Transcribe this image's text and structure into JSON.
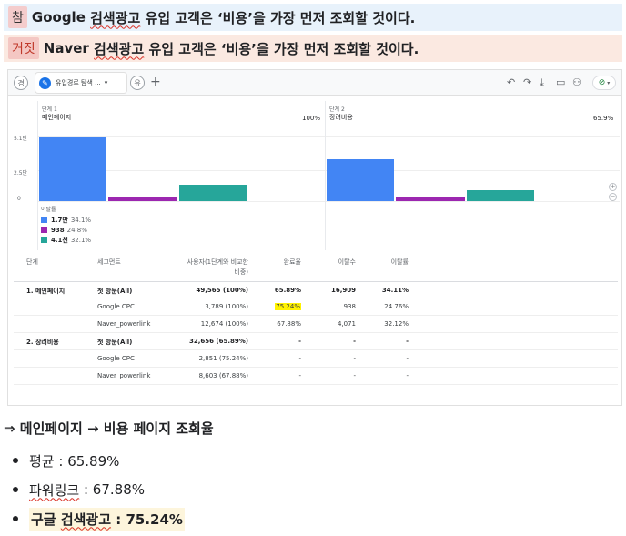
{
  "statements": {
    "true_tag": "참",
    "true_pre": "Google ",
    "true_squig": "검색광고",
    "true_post": " 유입 고객은 ‘비용’을 가장 먼저 조회할 것이다.",
    "false_tag": "거짓",
    "false_pre": "Naver ",
    "false_squig": "검색광고",
    "false_post": " 유입 고객은 ‘비용’을 가장 먼저 조회할 것이다."
  },
  "toolbar": {
    "left_badge": "경",
    "tab_label": "유입경로 탐색 ...",
    "tab_caret": "▾",
    "user_badge": "유",
    "add_label": "+",
    "icons": [
      "undo-icon",
      "redo-icon",
      "download-icon",
      "folder-icon",
      "share-user-icon",
      "status-check-icon"
    ],
    "undo_glyph": "↶",
    "redo_glyph": "↷",
    "download_glyph": "⤓",
    "folder_glyph": "▭",
    "share_glyph": "⚇",
    "check_glyph": "⊘",
    "check_caret": "▾"
  },
  "funnel": {
    "y_ticks": [
      "5.1만",
      "2.5만",
      "0"
    ],
    "step1": {
      "head": "단계 1",
      "name": "메인페이지",
      "pct": "100%"
    },
    "step2": {
      "head": "단계 2",
      "name": "장려비용",
      "pct": "65.9%"
    },
    "zoom_in": "+",
    "zoom_out": "−",
    "legend_title": "이탈률",
    "legend": [
      {
        "value": "1.7만",
        "pct": "34.1%",
        "color": "#4285f4"
      },
      {
        "value": "938",
        "pct": "24.8%",
        "color": "#9c27b0"
      },
      {
        "value": "4.1천",
        "pct": "32.1%",
        "color": "#26a69a"
      }
    ]
  },
  "chart_data": {
    "type": "bar",
    "categories": [
      "메인페이지",
      "장려비용"
    ],
    "ylim": [
      0,
      51000
    ],
    "series": [
      {
        "name": "첫 방문(All)",
        "values": [
          49565,
          32656
        ],
        "color": "#4285f4"
      },
      {
        "name": "Google CPC",
        "values": [
          3789,
          2851
        ],
        "color": "#9c27b0"
      },
      {
        "name": "Naver_powerlink",
        "values": [
          12674,
          8603
        ],
        "color": "#26a69a"
      }
    ]
  },
  "table": {
    "headers": [
      "단계",
      "세그먼트",
      "사용자(1단계와 비교한",
      "비중)",
      "완료율",
      "이탈수",
      "이탈률"
    ],
    "rows": [
      {
        "step": "1. 메인페이지",
        "seg": "첫 방문(All)",
        "users": "49,565 (100%)",
        "rate": "65.89%",
        "drop": "16,909",
        "droprate": "34.11%",
        "bold": true
      },
      {
        "step": "",
        "seg": "Google CPC",
        "users": "3,789 (100%)",
        "rate": "75.24%",
        "drop": "938",
        "droprate": "24.76%",
        "bold": false,
        "hl": true
      },
      {
        "step": "",
        "seg": "Naver_powerlink",
        "users": "12,674 (100%)",
        "rate": "67.88%",
        "drop": "4,071",
        "droprate": "32.12%",
        "bold": false
      },
      {
        "step": "2. 장려비용",
        "seg": "첫 방문(All)",
        "users": "32,656 (65.89%)",
        "rate": "-",
        "drop": "-",
        "droprate": "-",
        "bold": true
      },
      {
        "step": "",
        "seg": "Google CPC",
        "users": "2,851 (75.24%)",
        "rate": "-",
        "drop": "-",
        "droprate": "-",
        "bold": false
      },
      {
        "step": "",
        "seg": "Naver_powerlink",
        "users": "8,603 (67.88%)",
        "rate": "-",
        "drop": "-",
        "droprate": "-",
        "bold": false
      }
    ]
  },
  "summary": {
    "title": "⇒ 메인페이지 → 비용 페이지 조회율",
    "b1_pre": "평균 : 65.89%",
    "b2_squig": "파워링크",
    "b2_post": " : 67.88%",
    "b3_pre": "구글 ",
    "b3_squig": "검색광고",
    "b3_post": " : 75.24%"
  }
}
